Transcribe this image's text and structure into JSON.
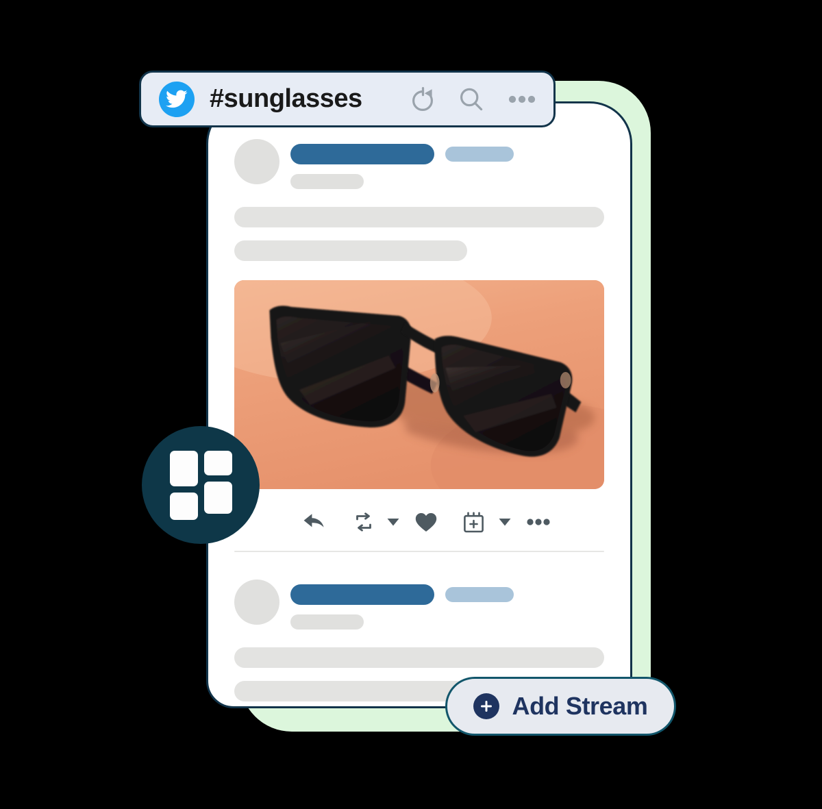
{
  "stream_header": {
    "network_icon": "twitter-bird-icon",
    "network_color": "#1DA1F2",
    "title": "#sunglasses",
    "icons": [
      {
        "name": "refresh-icon",
        "label": "Refresh"
      },
      {
        "name": "search-icon",
        "label": "Search"
      },
      {
        "name": "more-options-icon",
        "label": "More options"
      }
    ]
  },
  "brand": {
    "logo_icon": "hootsuite-grid-logo-icon",
    "logo_background": "#0E3748",
    "logo_tile_color": "#FDFDFD"
  },
  "feed": {
    "posts": [
      {
        "avatar": "avatar-placeholder",
        "name_placeholder": "name-skeleton-bar",
        "handle_placeholder": "handle-skeleton-bar",
        "meta_placeholder": "meta-skeleton-bar",
        "body_lines": [
          "text-line-full",
          "text-line-short"
        ],
        "media": {
          "name": "sunglasses-photo",
          "alt": "Black sunglasses on a peach background",
          "background_color": "#EE9F77",
          "frame_color": "#15161C"
        },
        "actions": [
          {
            "name": "reply-icon",
            "label": "Reply"
          },
          {
            "name": "retweet-icon",
            "label": "Retweet"
          },
          {
            "name": "retweet-dropdown-icon",
            "label": "Retweet options"
          },
          {
            "name": "like-heart-icon",
            "label": "Like"
          },
          {
            "name": "schedule-calendar-icon",
            "label": "Schedule"
          },
          {
            "name": "schedule-dropdown-icon",
            "label": "Schedule options"
          },
          {
            "name": "post-more-icon",
            "label": "More"
          }
        ]
      },
      {
        "avatar": "avatar-placeholder",
        "name_placeholder": "name-skeleton-bar",
        "handle_placeholder": "handle-skeleton-bar",
        "meta_placeholder": "meta-skeleton-bar",
        "body_lines": [
          "text-line-full",
          "text-line-short"
        ]
      }
    ]
  },
  "add_stream": {
    "icon": "plus-circle-icon",
    "label": "Add Stream",
    "text_color": "#1F3460",
    "background": "#E7EAF0",
    "border_color": "#12566B"
  },
  "colors": {
    "page_background": "#000000",
    "card_background": "#FFFFFF",
    "card_border": "#12344A",
    "accent_green": "#DCF6DC",
    "header_background": "#E7ECF5",
    "skeleton_gray": "#E3E3E1",
    "skeleton_name_blue": "#2E6A99",
    "skeleton_handle_blue": "#A9C4DA",
    "action_icon_gray": "#4E5A61",
    "header_icon_gray": "#9AA3AC"
  }
}
